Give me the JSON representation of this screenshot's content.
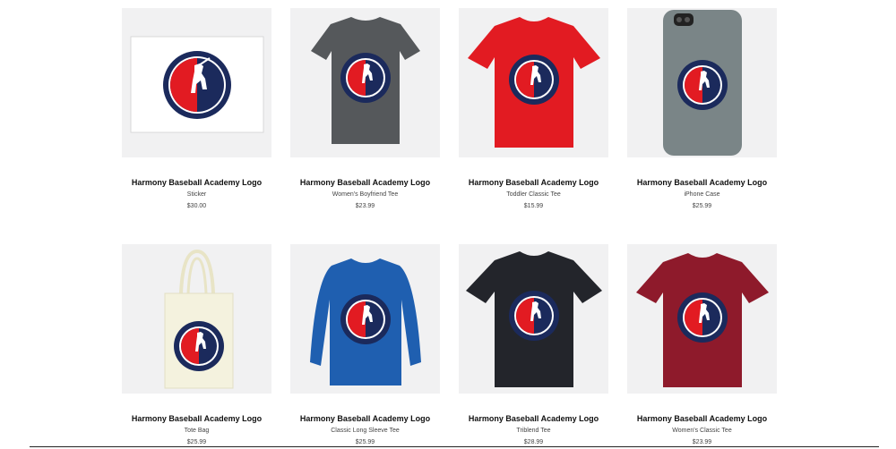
{
  "products": [
    {
      "title": "Harmony Baseball Academy Logo",
      "type": "Sticker",
      "price": "$30.00",
      "item": "sticker",
      "color": "#ffffff"
    },
    {
      "title": "Harmony Baseball Academy Logo",
      "type": "Women's Boyfriend Tee",
      "price": "$23.99",
      "item": "tshirt",
      "color": "#55585b"
    },
    {
      "title": "Harmony Baseball Academy Logo",
      "type": "Toddler Classic Tee",
      "price": "$15.99",
      "item": "tshirt",
      "color": "#e21b22"
    },
    {
      "title": "Harmony Baseball Academy Logo",
      "type": "iPhone Case",
      "price": "$25.99",
      "item": "phone",
      "color": "#7a8587"
    },
    {
      "title": "Harmony Baseball Academy Logo",
      "type": "Tote Bag",
      "price": "$25.99",
      "item": "tote",
      "color": "#f4f2de"
    },
    {
      "title": "Harmony Baseball Academy Logo",
      "type": "Classic Long Sleeve Tee",
      "price": "$25.99",
      "item": "longsleeve",
      "color": "#1f5fb0"
    },
    {
      "title": "Harmony Baseball Academy Logo",
      "type": "Triblend Tee",
      "price": "$28.99",
      "item": "tshirt",
      "color": "#23252b"
    },
    {
      "title": "Harmony Baseball Academy Logo",
      "type": "Women's Classic Tee",
      "price": "$23.99",
      "item": "tshirt",
      "color": "#8e1a2b"
    }
  ]
}
